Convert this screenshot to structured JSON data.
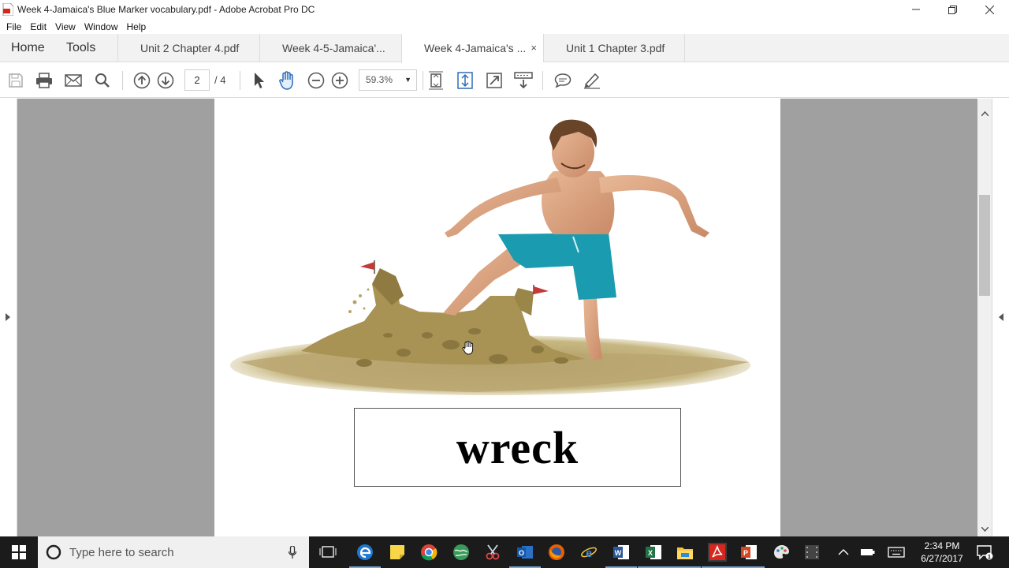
{
  "window": {
    "title": "Week 4-Jamaica's Blue Marker vocabulary.pdf - Adobe Acrobat Pro DC"
  },
  "menu": [
    "File",
    "Edit",
    "View",
    "Window",
    "Help"
  ],
  "tabs": {
    "home": "Home",
    "tools": "Tools",
    "documents": [
      {
        "label": "Unit 2 Chapter 4.pdf",
        "active": false
      },
      {
        "label": "Week 4-5-Jamaica'...",
        "active": false
      },
      {
        "label": "Week 4-Jamaica's ...",
        "active": true
      },
      {
        "label": "Unit 1 Chapter 3.pdf",
        "active": false
      }
    ],
    "close_glyph": "×"
  },
  "toolbar": {
    "current_page": "2",
    "total_pages": "/ 4",
    "zoom": "59.3%"
  },
  "document": {
    "vocab_word": "wreck"
  },
  "taskbar": {
    "search_placeholder": "Type here to search",
    "time": "2:34 PM",
    "date": "6/27/2017"
  },
  "colors": {
    "acrobat_red": "#d7261e",
    "taskbar_bg": "#1b1b1b",
    "page_bg": "#a0a0a0",
    "shorts_teal": "#1a9bb0",
    "sand": "#b6a168"
  }
}
